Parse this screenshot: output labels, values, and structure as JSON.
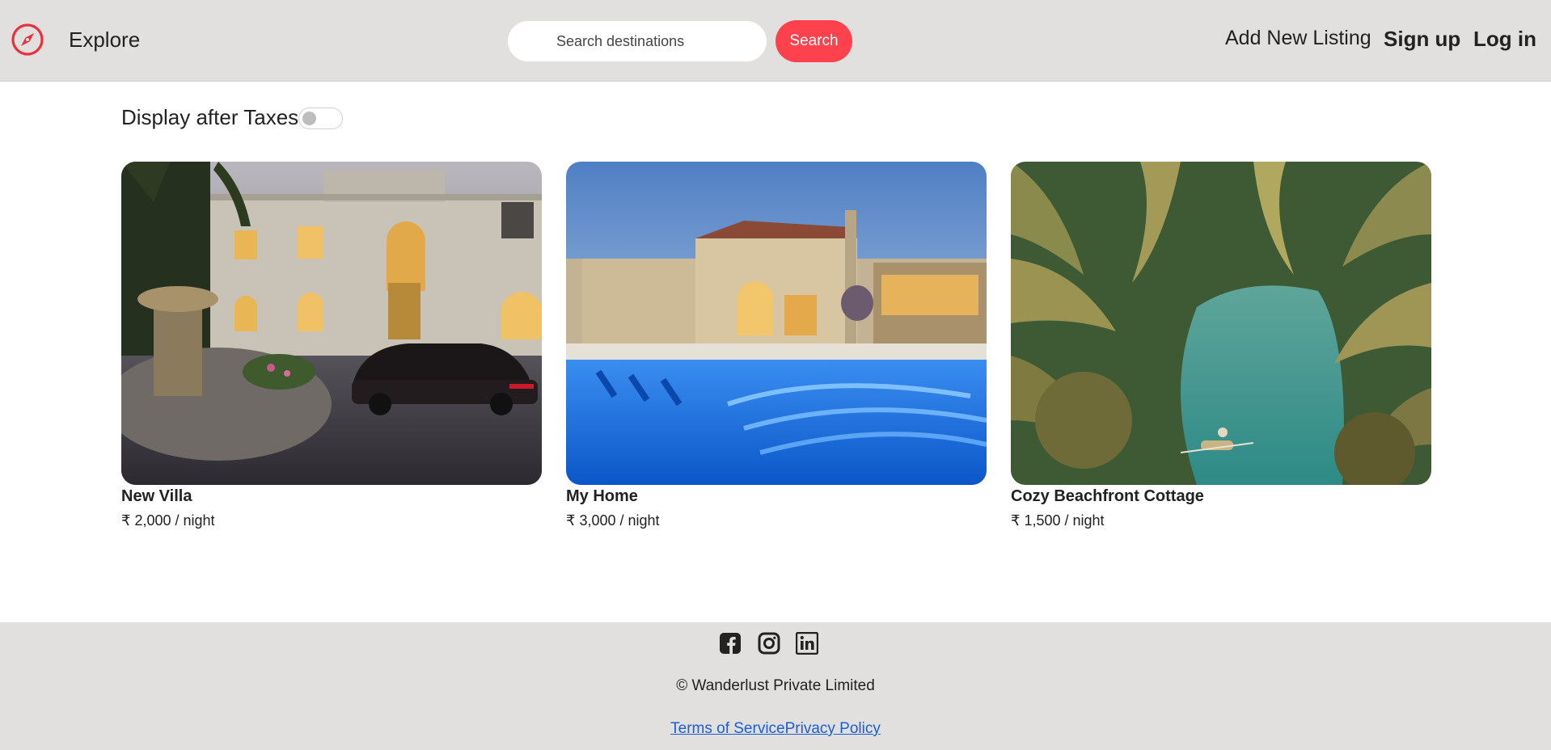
{
  "nav": {
    "brand_icon": "compass-icon",
    "explore": "Explore",
    "search_placeholder": "Search destinations",
    "search_button": "Search",
    "add_listing": "Add New Listing",
    "signup": "Sign up",
    "login": "Log in"
  },
  "filters": {
    "tax_label": "Display after Taxes",
    "tax_toggle_on": false
  },
  "listings": [
    {
      "title": "New Villa",
      "price": "₹ 2,000 / night",
      "image": "villa-photo"
    },
    {
      "title": "My Home",
      "price": "₹ 3,000 / night",
      "image": "pool-house-photo"
    },
    {
      "title": "Cozy Beachfront Cottage",
      "price": "₹ 1,500 / night",
      "image": "palm-river-photo"
    }
  ],
  "footer": {
    "socials": [
      "facebook-icon",
      "instagram-icon",
      "linkedin-icon"
    ],
    "copyright": "© Wanderlust Private Limited",
    "terms": "Terms of Service",
    "privacy": "Privacy Policy"
  },
  "colors": {
    "accent": "#fe424d",
    "navbar_bg": "#e2dfdf",
    "link": "#1a5fd6"
  }
}
